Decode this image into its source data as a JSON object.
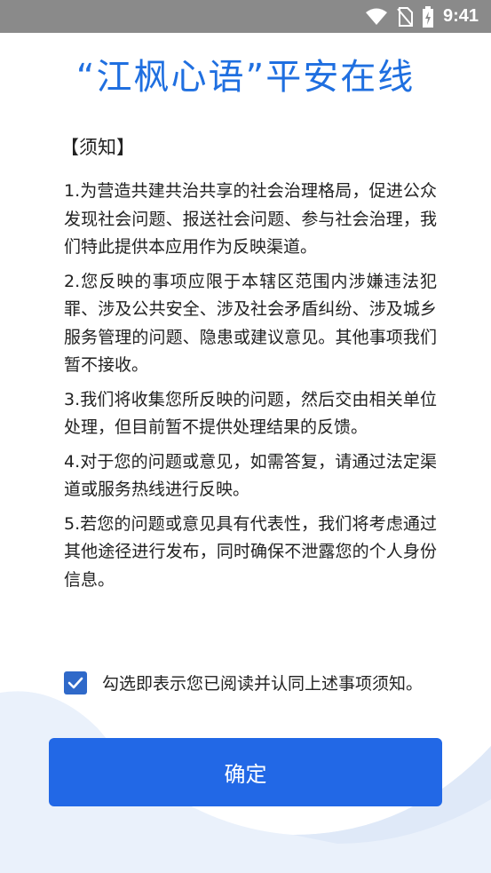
{
  "status_bar": {
    "time": "9:41",
    "icons": [
      "wifi-icon",
      "no-sim-icon",
      "battery-charging-icon"
    ]
  },
  "page": {
    "title": "“江枫心语”平安在线",
    "notice_heading": "【须知】",
    "notice_items": [
      "1.为营造共建共治共享的社会治理格局，促进公众发现社会问题、报送社会问题、参与社会治理，我们特此提供本应用作为反映渠道。",
      "2.您反映的事项应限于本辖区范围内涉嫌违法犯罪、涉及公共安全、涉及社会矛盾纠纷、涉及城乡服务管理的问题、隐患或建议意见。其他事项我们暂不接收。",
      "3.我们将收集您所反映的问题，然后交由相关单位处理，但目前暂不提供处理结果的反馈。",
      "4.对于您的问题或意见，如需答复，请通过法定渠道或服务热线进行反映。",
      "5.若您的问题或意见具有代表性，我们将考虑通过其他途径进行发布，同时确保不泄露您的个人身份信息。"
    ],
    "agree": {
      "checked": true,
      "label": "勾选即表示您已阅读并认同上述事项须知。"
    },
    "confirm_label": "确定"
  },
  "colors": {
    "status_bar": "#8a8a8a",
    "title": "#1f6fe0",
    "checkbox": "#2f69c9",
    "button": "#2268e6",
    "background_wave": "#eaf1fb"
  }
}
